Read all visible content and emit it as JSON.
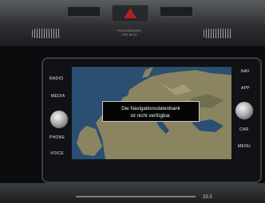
{
  "dashboard": {
    "airbag_label": "PASSENGER\nAIR BAG",
    "temperature": "23.5"
  },
  "left_buttons": [
    "RADIO",
    "MEDIA",
    "PHONE",
    "VOICE"
  ],
  "right_buttons": [
    "NAV",
    "APP",
    "CAR",
    "MENU"
  ],
  "dialog": {
    "line1": "Die Navigationsdatenbank",
    "line2": "ist nicht verfügbar."
  },
  "colors": {
    "sea": "#2a4f73",
    "land": "#8a8460",
    "hazard": "#b02222"
  },
  "icons": [
    "hazard-triangle-icon",
    "volume-knob-icon",
    "tune-knob-icon",
    "air-vent-icon"
  ]
}
